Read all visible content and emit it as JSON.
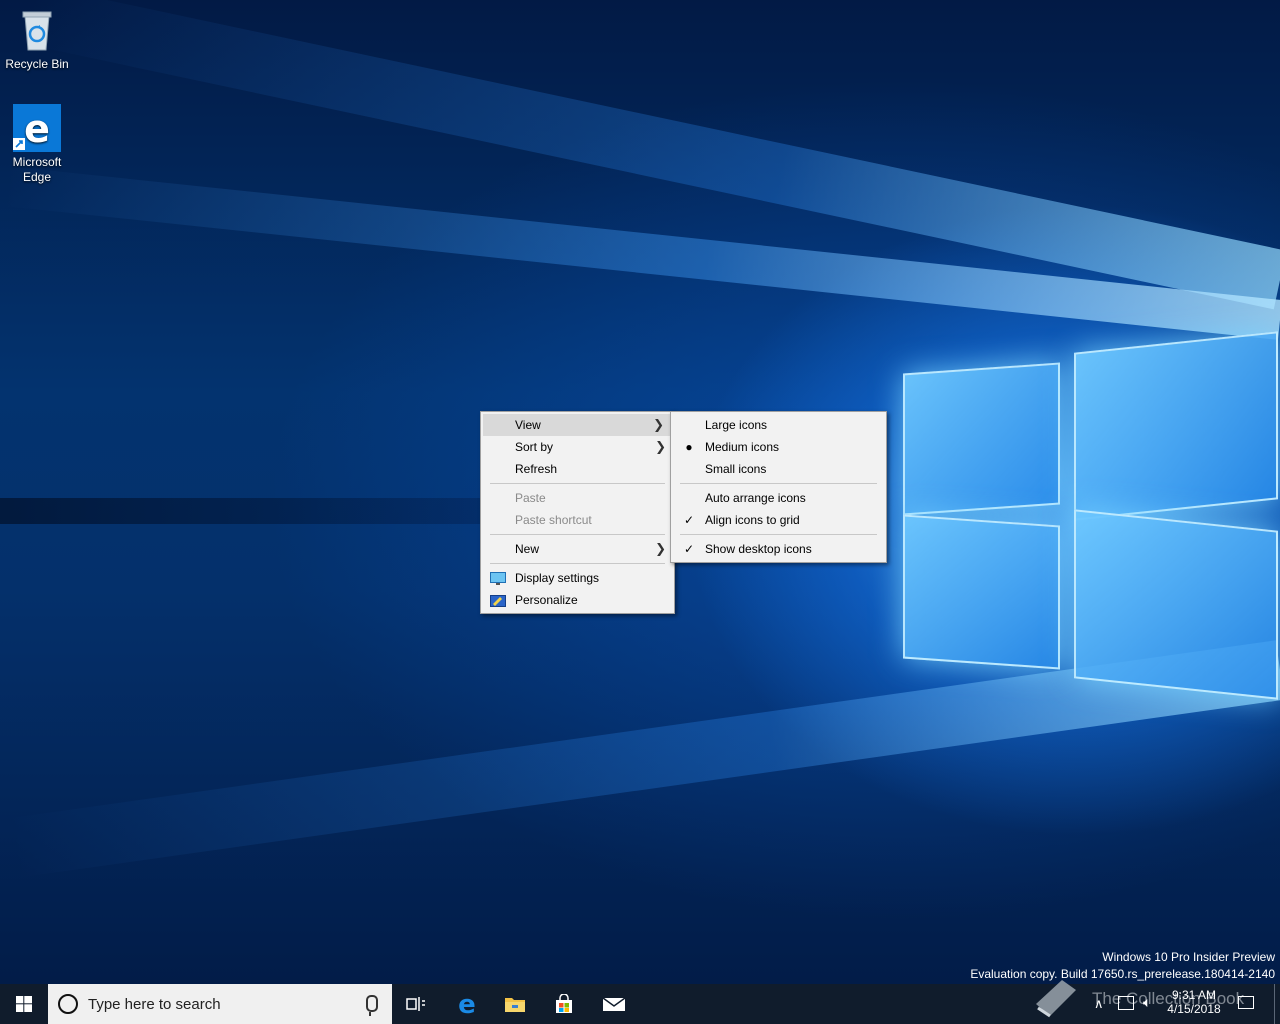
{
  "desktop": {
    "icons": [
      {
        "label": "Recycle Bin",
        "icon": "recycle-bin-icon"
      },
      {
        "label": "Microsoft\nEdge",
        "label_line1": "Microsoft",
        "label_line2": "Edge",
        "icon": "edge-icon"
      }
    ],
    "watermark": {
      "line1": "Windows 10 Pro Insider Preview",
      "line2": "Evaluation copy. Build 17650.rs_prerelease.180414-2140"
    },
    "overlay_text": "The Collection Book"
  },
  "context_menu": {
    "items": [
      {
        "label": "View",
        "submenu": true,
        "highlighted": true
      },
      {
        "label": "Sort by",
        "submenu": true
      },
      {
        "label": "Refresh"
      },
      {
        "label": "Paste",
        "disabled": true
      },
      {
        "label": "Paste shortcut",
        "disabled": true
      },
      {
        "label": "New",
        "submenu": true
      },
      {
        "label": "Display settings",
        "icon": "display-settings-icon"
      },
      {
        "label": "Personalize",
        "icon": "personalize-icon"
      }
    ]
  },
  "view_submenu": {
    "items": [
      {
        "label": "Large icons"
      },
      {
        "label": "Medium icons",
        "mark": "bullet"
      },
      {
        "label": "Small icons"
      },
      {
        "label": "Auto arrange icons"
      },
      {
        "label": "Align icons to grid",
        "mark": "check"
      },
      {
        "label": "Show desktop icons",
        "mark": "check"
      }
    ]
  },
  "taskbar": {
    "search_placeholder": "Type here to search",
    "pinned": [
      "task-view-icon",
      "edge-icon",
      "file-explorer-icon",
      "store-icon",
      "mail-icon"
    ],
    "clock": {
      "time": "9:31 AM",
      "date": "4/15/2018"
    },
    "accent": "#0078d7",
    "background": "#101c2c"
  }
}
